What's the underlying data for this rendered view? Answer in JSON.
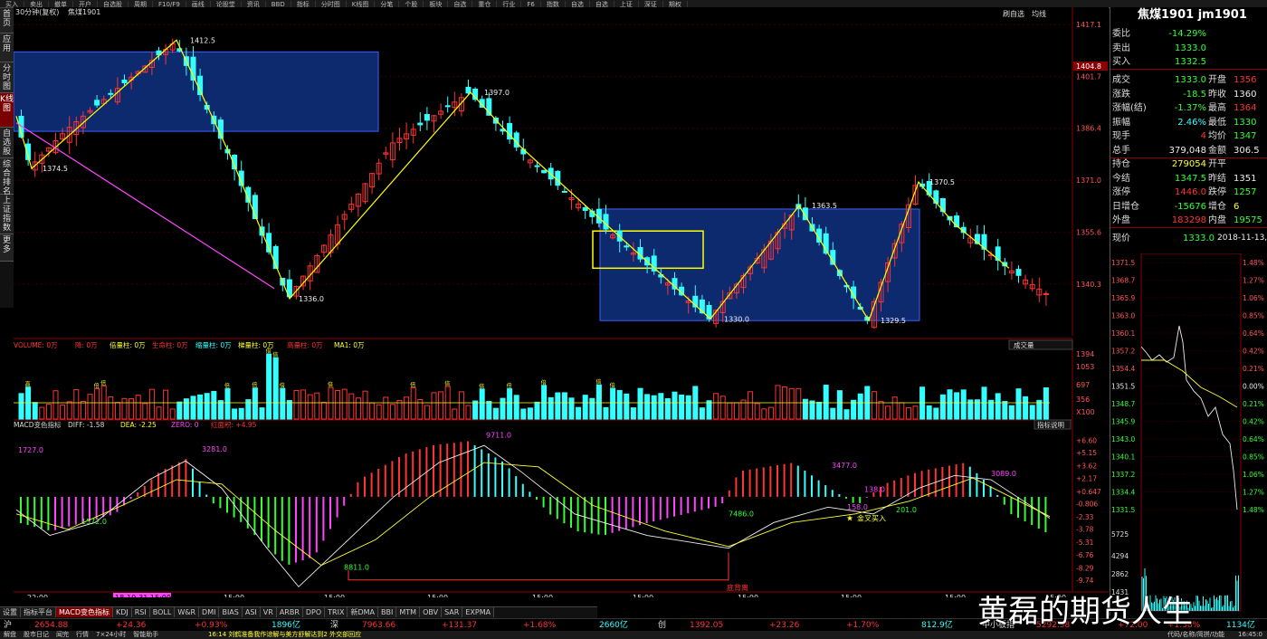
{
  "toolbar": {
    "items": [
      "买入",
      "卖出",
      "撤单",
      "开户",
      "自选股",
      "周期",
      "F10/F9",
      "画线",
      "论股堂",
      "资讯",
      "BBD",
      "指标",
      "分时图",
      "K线图",
      "分笔",
      "个股",
      "板块",
      "自选",
      "重仓",
      "行业",
      "F6",
      "指数",
      "自选",
      "自选",
      "上证",
      "深证",
      "期权"
    ]
  },
  "left_nav": [
    "首页",
    "应用",
    "分时图",
    "K线图",
    "自选股",
    "综合排名",
    "上证指数",
    "更多"
  ],
  "chart_header": {
    "period": "30分钟(复权)",
    "symbol": "焦煤1901",
    "buttons": [
      "刷自选",
      "均线"
    ]
  },
  "price_axis": [
    "1417.1",
    "1404.8",
    "1401.7",
    "1386.4",
    "1371.0",
    "1355.6",
    "1340.3"
  ],
  "price_annotations": [
    "1412.5",
    "1374.5",
    "1336.0",
    "1397.0",
    "1370.5",
    "1363.5",
    "1330.0",
    "1329.5"
  ],
  "volume_header": {
    "legend": [
      "VOLUME: 0万",
      "降: 0万",
      "倍量柱: 0万",
      "生命柱: 0万",
      "缩量柱: 0万",
      "梯量柱: 0万",
      "高量柱: 0万",
      "MA1: 0万"
    ],
    "dropdown": "成交量"
  },
  "volume_axis": [
    "1394",
    "1053",
    "697",
    "356",
    "X100"
  ],
  "volume_marks": [
    "高",
    "倍",
    "倍",
    "倍",
    "倍",
    "倍",
    "倍",
    "倍",
    "倍",
    "倍",
    "倍",
    "倍",
    "倍",
    "倍",
    "倍",
    "倍"
  ],
  "macd_header": {
    "name": "MACD变色指标",
    "diff": "DIFF: -1.58",
    "dea": "DEA: -2.25",
    "zero": "ZERO: 0",
    "red": "红面积: +4.95",
    "help": "指标说明"
  },
  "macd_axis": [
    "+6.60",
    "+5.15",
    "+3.62",
    "+2.17",
    "+0.647",
    "-0.806",
    "-2.33",
    "-3.78",
    "-5.31",
    "-6.76",
    "-8.29",
    "-9.74"
  ],
  "macd_annotations": [
    "1727.0",
    "3281.0",
    "1572.0",
    "9711.0",
    "8811.0",
    "7486.0",
    "3477.0",
    "138.0",
    "158.0",
    "201.0",
    "3089.0"
  ],
  "macd_labels": {
    "cross": "金叉买入",
    "divergence": "底背离"
  },
  "time_axis": [
    "22:00",
    "18-10-31 15:00",
    "15:00",
    "15:00",
    "15:00",
    "15:00",
    "15:00",
    "15:00",
    "15:00",
    "15:00",
    "15:00"
  ],
  "bottom_tabs": [
    "设置",
    "指标平台",
    "MACD变色指标",
    "KDJ",
    "RSI",
    "BOLL",
    "W&R",
    "DMI",
    "BIAS",
    "ASI",
    "VR",
    "ARBR",
    "DPO",
    "TRIX",
    "新DMA",
    "BBI",
    "MTM",
    "OBV",
    "SAR",
    "EXPMA"
  ],
  "ticker": {
    "sh_label": "沪",
    "sh_val": "2654.88",
    "sh_chg": "+24.36",
    "sh_pct": "+0.93%",
    "sh_amt": "1896亿",
    "sz_label": "深",
    "sz_val": "7963.66",
    "sz_chg": "+131.37",
    "sz_pct": "+1.68%",
    "sz_amt": "2660亿",
    "cy_label": "创",
    "cy_val": "1392.05",
    "cy_chg": "+23.26",
    "cy_pct": "+1.70%",
    "cy_amt": "812.9亿",
    "zz_label": "中小板指",
    "zz_val": "5292.58",
    "zz_chg": "+72.00",
    "zz_pct": "+1.38%",
    "zz_amt": "1134亿"
  },
  "statusbar": {
    "items": [
      "解盘",
      "股市日记",
      "闻完",
      "行情",
      "7×24小时",
      "智能助手"
    ],
    "news": "16:14 刘鹤准备我作谅解与美方舒解达到2 外交部回应",
    "right": "代码/名称/简拼/功能",
    "time": "16:45:0"
  },
  "right_panel": {
    "title": "焦煤1901 jm1901",
    "rows": [
      {
        "l": "委比",
        "v": "-14.29%",
        "v2": "",
        "c": "grn"
      },
      {
        "l": "卖出",
        "v": "1333.0",
        "v2": "",
        "c": "grn"
      },
      {
        "l": "买入",
        "v": "1332.5",
        "v2": "",
        "c": "grn"
      },
      {
        "l": "成交",
        "v": "1333.0",
        "l2": "开盘",
        "v2": "1356",
        "c": "grn",
        "c2": "red"
      },
      {
        "l": "涨跌",
        "v": "-18.5",
        "l2": "昨收",
        "v2": "1360",
        "c": "grn",
        "c2": "wht"
      },
      {
        "l": "涨幅(结)",
        "v": "-1.37%",
        "l2": "最高",
        "v2": "1364",
        "c": "grn",
        "c2": "red"
      },
      {
        "l": "振幅",
        "v": "2.46%",
        "l2": "最低",
        "v2": "1330",
        "c": "cyn",
        "c2": "grn"
      },
      {
        "l": "现手",
        "v": "4",
        "l2": "均价",
        "v2": "1347",
        "c": "red",
        "c2": "grn"
      },
      {
        "l": "总手",
        "v": "379,048",
        "l2": "金额",
        "v2": "306.5",
        "c": "wht",
        "c2": "wht"
      },
      {
        "l": "持仓",
        "v": "279054",
        "l2": "开平",
        "v2": "",
        "c": "yel",
        "c2": "wht"
      },
      {
        "l": "今结",
        "v": "1347.5",
        "l2": "昨结",
        "v2": "1351",
        "c": "grn",
        "c2": "wht"
      },
      {
        "l": "涨停",
        "v": "1446.0",
        "l2": "跌停",
        "v2": "1257",
        "c": "red",
        "c2": "grn"
      },
      {
        "l": "日增仓",
        "v": "-15676",
        "l2": "增仓",
        "v2": "6",
        "c": "grn",
        "c2": "yel"
      },
      {
        "l": "外盘",
        "v": "183298",
        "l2": "内盘",
        "v2": "19575",
        "c": "red",
        "c2": "grn"
      }
    ],
    "now_label": "现价",
    "now_val": "1333.0",
    "now_time": "2018-11-13,",
    "intraday_axis": [
      "1371.5",
      "1368.7",
      "1365.9",
      "1363.0",
      "1360.1",
      "1357.2",
      "1354.4",
      "1351.5",
      "1348.7",
      "1345.9",
      "1343.0",
      "1340.1",
      "1337.2",
      "1334.4",
      "1331.5"
    ],
    "intraday_pct": [
      "1.48%",
      "1.27%",
      "1.06%",
      "0.85%",
      "0.64%",
      "0.42%",
      "0.21%",
      "0.00%",
      "0.21%",
      "0.42%",
      "0.64%",
      "0.85%",
      "1.06%",
      "1.27%",
      "1.48%"
    ],
    "intraday_vol": [
      "5725",
      "4294",
      "2862",
      "1431"
    ]
  },
  "watermark": "黄磊的期货人生",
  "colors": {
    "up": "#ff3333",
    "down": "#33ffff",
    "zigzag": "#ffff00",
    "box": "#0d2a6e",
    "boxborder": "#3a60ff",
    "trend": "#ff44ff"
  }
}
